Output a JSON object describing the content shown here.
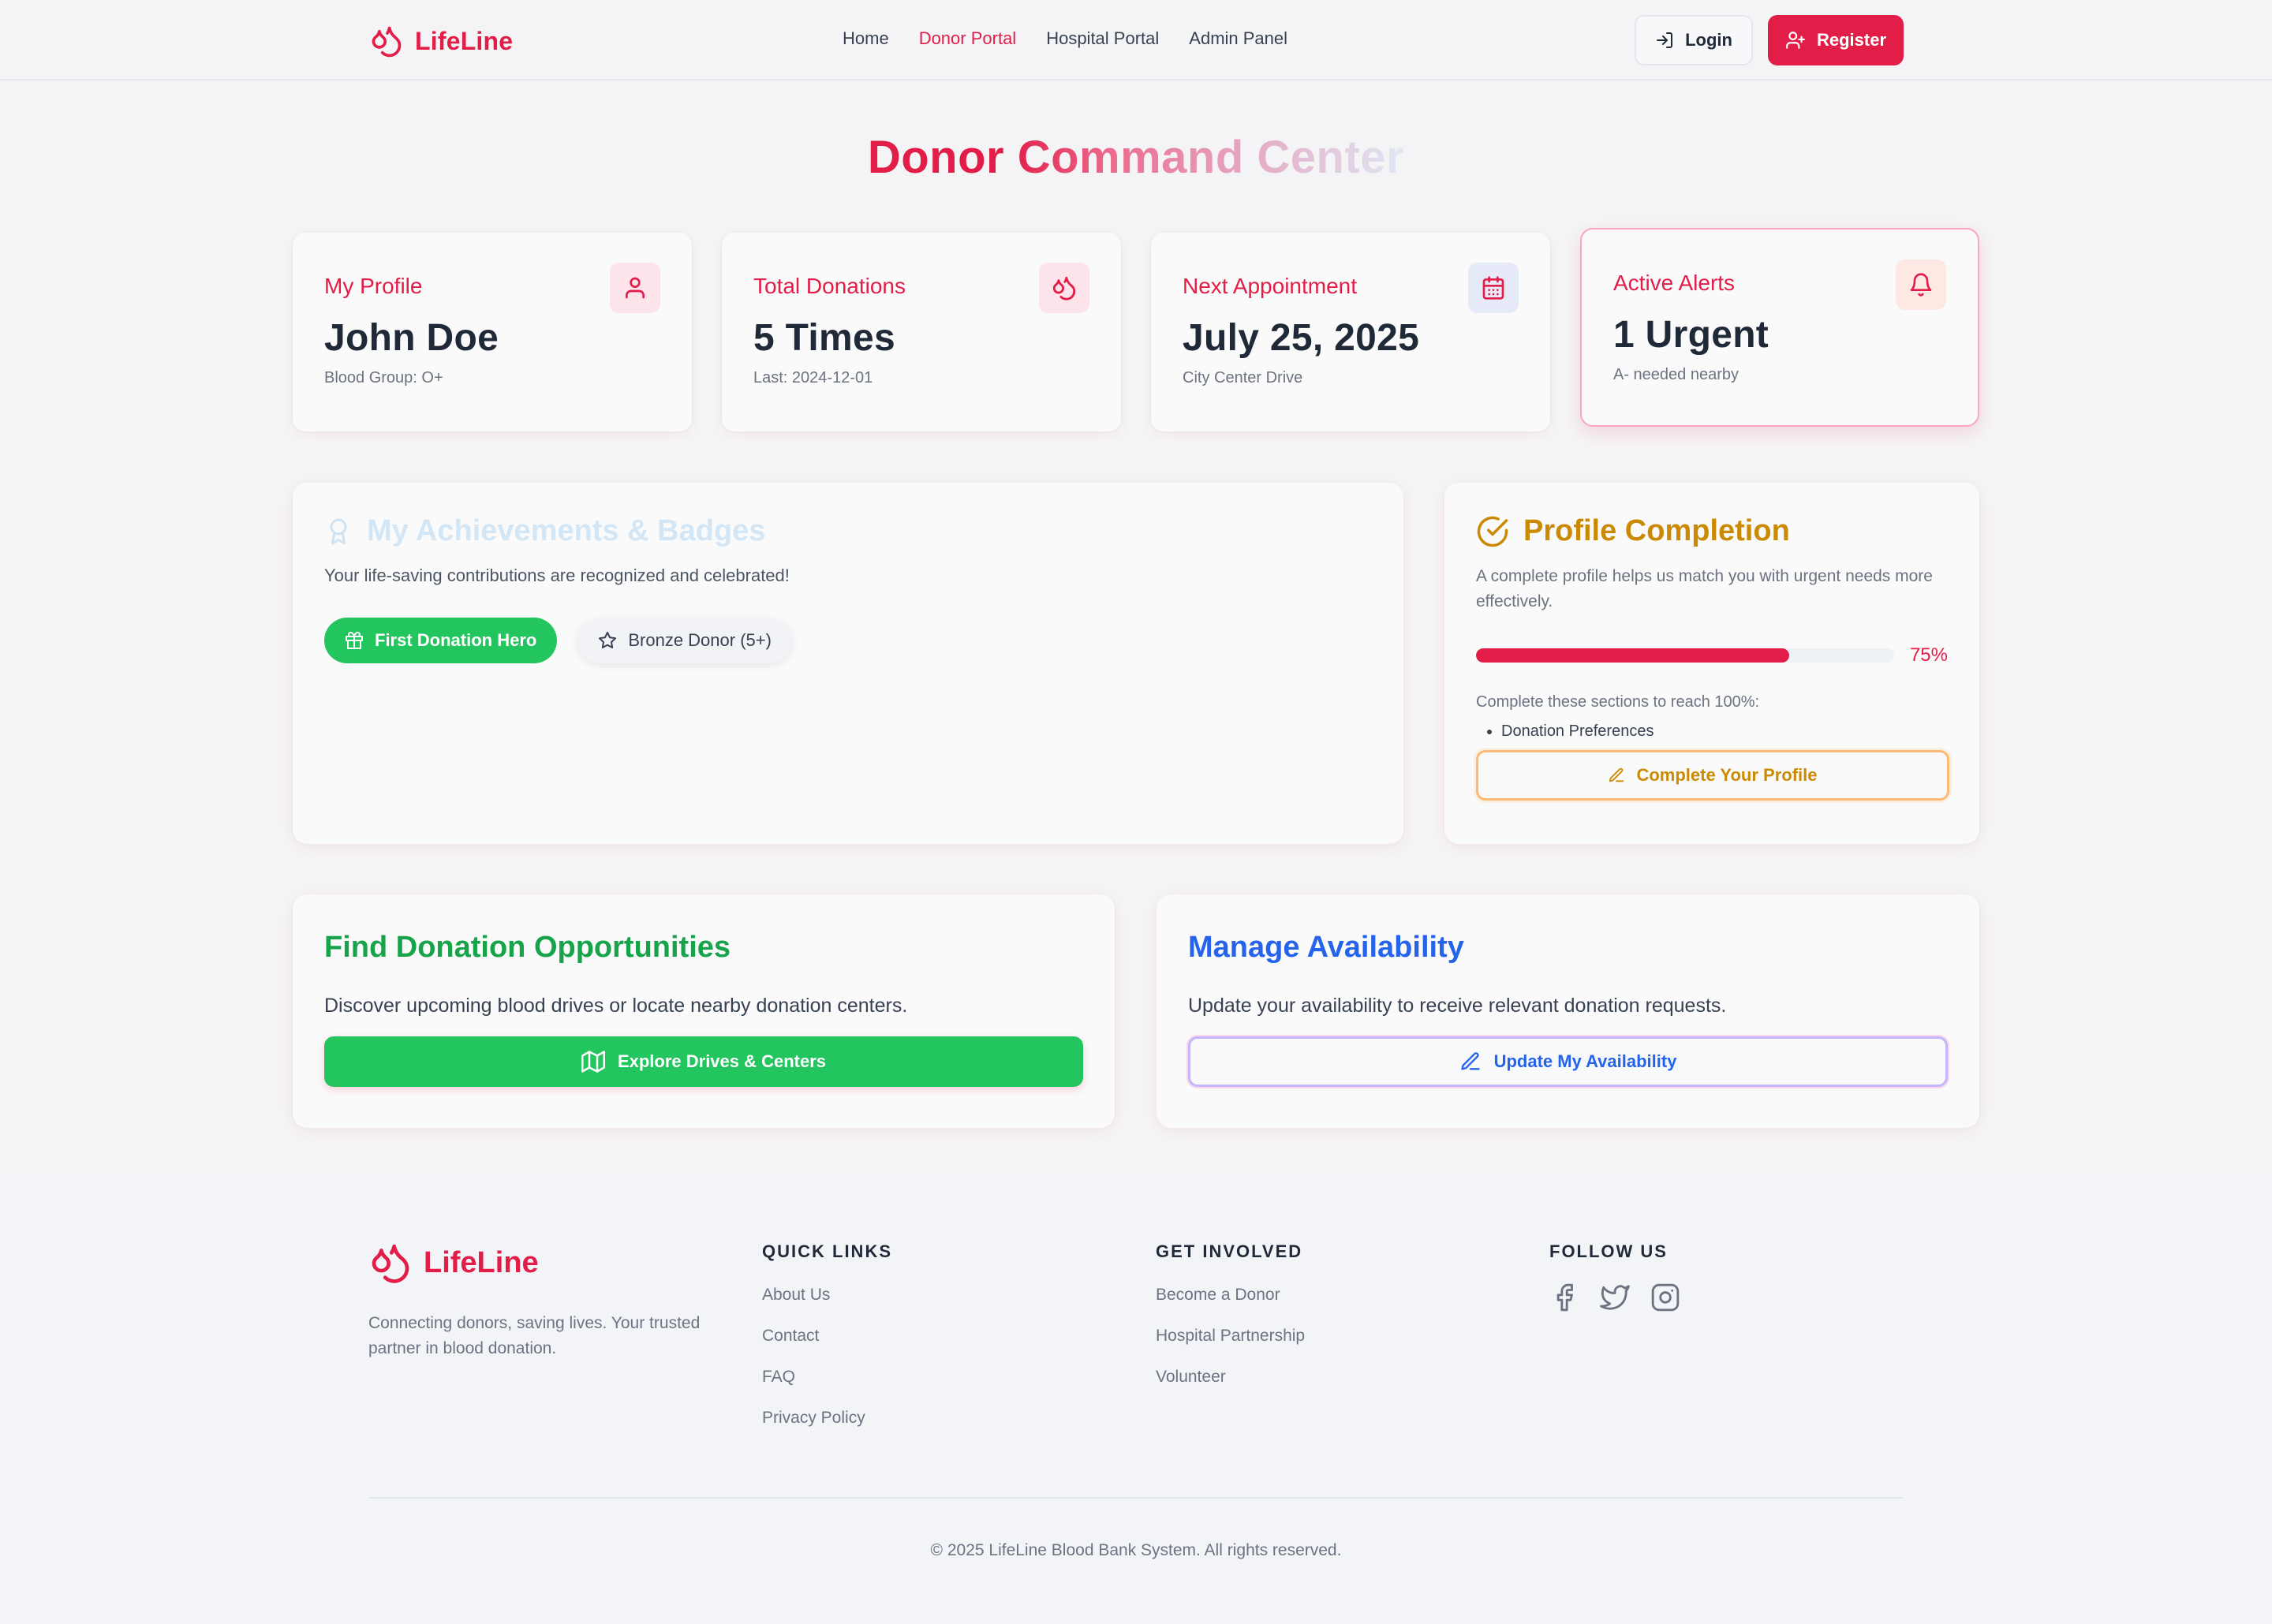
{
  "nav": {
    "brand": "LifeLine",
    "links": [
      {
        "label": "Home",
        "active": false
      },
      {
        "label": "Donor Portal",
        "active": true
      },
      {
        "label": "Hospital Portal",
        "active": false
      },
      {
        "label": "Admin Panel",
        "active": false
      }
    ],
    "login_label": "Login",
    "register_label": "Register"
  },
  "page": {
    "title": "Donor Command Center"
  },
  "stats": {
    "profile": {
      "label": "My Profile",
      "value": "John Doe",
      "sub": "Blood Group: O+",
      "icon": "user-icon"
    },
    "donations": {
      "label": "Total Donations",
      "value": "5 Times",
      "sub": "Last: 2024-12-01",
      "icon": "droplets-icon"
    },
    "appointment": {
      "label": "Next Appointment",
      "value": "July 25, 2025",
      "sub": "City Center Drive",
      "icon": "calendar-icon"
    },
    "alerts": {
      "label": "Active Alerts",
      "value": "1 Urgent",
      "sub": "A- needed nearby",
      "icon": "bell-icon"
    }
  },
  "achievements": {
    "title": "My Achievements & Badges",
    "description": "Your life-saving contributions are recognized and celebrated!",
    "badges": [
      {
        "label": "First Donation Hero",
        "icon": "gift-icon"
      },
      {
        "label": "Bronze Donor (5+)",
        "icon": "star-icon"
      }
    ]
  },
  "profile_completion": {
    "title": "Profile Completion",
    "description": "A complete profile helps us match you with urgent needs more effectively.",
    "progress": 0.75,
    "progress_label": "75%",
    "hint": "Complete these sections to reach 100%:",
    "missing_sections": [
      "Donation Preferences"
    ],
    "button_label": "Complete Your Profile"
  },
  "opportunities": {
    "title": "Find Donation Opportunities",
    "description": "Discover upcoming blood drives or locate nearby donation centers.",
    "button_label": "Explore Drives & Centers"
  },
  "availability": {
    "title": "Manage Availability",
    "description": "Update your availability to receive relevant donation requests.",
    "button_label": "Update My Availability"
  },
  "footer": {
    "brand": "LifeLine",
    "tagline": "Connecting donors, saving lives. Your trusted partner in blood donation.",
    "quick_links": {
      "heading": "QUICK LINKS",
      "items": [
        "About Us",
        "Contact",
        "FAQ",
        "Privacy Policy"
      ]
    },
    "get_involved": {
      "heading": "GET INVOLVED",
      "items": [
        "Become a Donor",
        "Hospital Partnership",
        "Volunteer"
      ]
    },
    "follow": {
      "heading": "FOLLOW US",
      "icons": [
        "facebook-icon",
        "twitter-icon",
        "instagram-icon"
      ]
    },
    "copyright": "© 2025 LifeLine Blood Bank System. All rights reserved."
  },
  "colors": {
    "brand": "#e11d48",
    "green": "#22c55e",
    "amber": "#ca8a04",
    "blue": "#2563eb",
    "page_bg": "#f4f4f6"
  }
}
